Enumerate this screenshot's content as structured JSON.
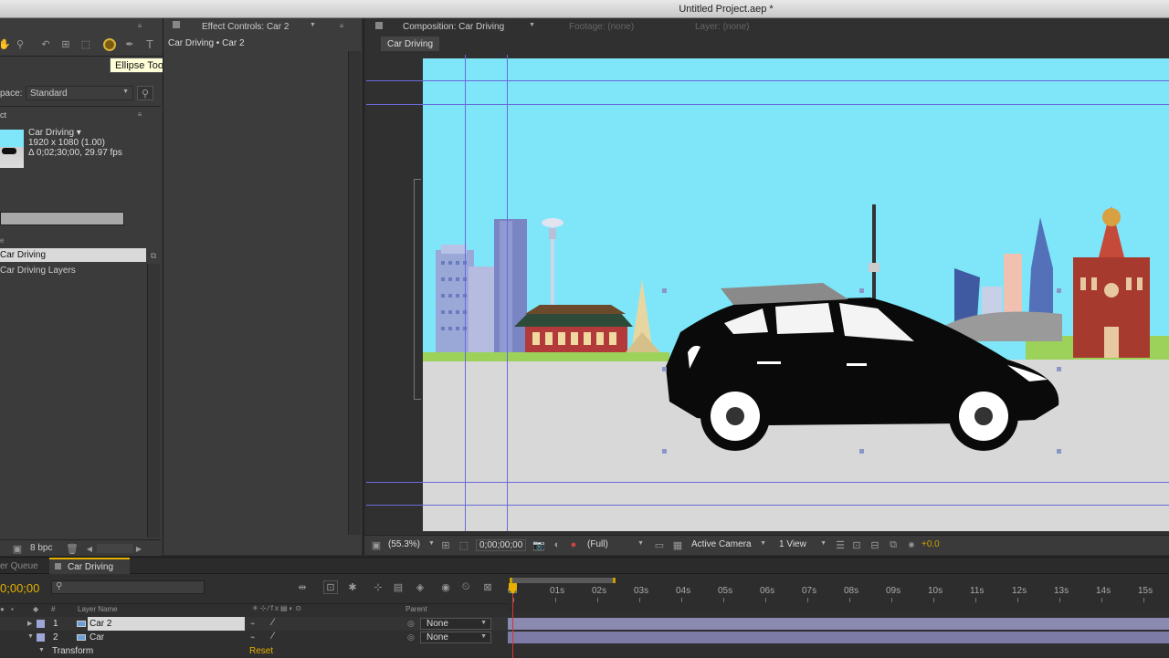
{
  "window": {
    "title": "Untitled Project.aep *"
  },
  "toolbar": {
    "tooltip": "Ellipse Tool (Q)"
  },
  "workspace": {
    "label": "pace:",
    "value": "Standard"
  },
  "project": {
    "panel_label": "ct",
    "comp_name": "Car Driving ▾",
    "comp_size": "1920 x 1080 (1.00)",
    "comp_duration": "Δ 0;02;30;00, 29.97 fps",
    "column_header": "e",
    "items": [
      "Car Driving",
      "Car Driving Layers"
    ],
    "bpc": "8 bpc"
  },
  "effect_controls": {
    "tab": "Effect Controls: Car 2",
    "subtitle": "Car Driving • Car 2"
  },
  "composition": {
    "tab": "Composition: Car Driving",
    "footage": "Footage: (none)",
    "layer": "Layer: (none)",
    "comp_tab": "Car Driving",
    "zoom": "(55.3%)",
    "timecode": "0;00;00;00",
    "resolution": "(Full)",
    "camera": "Active Camera",
    "views": "1 View",
    "exposure": "+0.0"
  },
  "timeline": {
    "render_queue_tab": "er Queue",
    "comp_tab": "Car Driving",
    "current_time": "0;00;00",
    "col_number": "#",
    "col_layer_name": "Layer Name",
    "col_parent": "Parent",
    "ruler": [
      "0s",
      "01s",
      "02s",
      "03s",
      "04s",
      "05s",
      "06s",
      "07s",
      "08s",
      "09s",
      "10s",
      "11s",
      "12s",
      "13s",
      "14s",
      "15s"
    ],
    "layers": [
      {
        "num": "1",
        "name": "Car 2",
        "parent": "None"
      },
      {
        "num": "2",
        "name": "Car",
        "parent": "None"
      }
    ],
    "transform_label": "Transform",
    "reset_label": "Reset"
  },
  "colors": {
    "accent": "#e5b000",
    "sky": "#7ee6f8",
    "selection": "#d9d9d9",
    "label": "#9ea6d8"
  }
}
